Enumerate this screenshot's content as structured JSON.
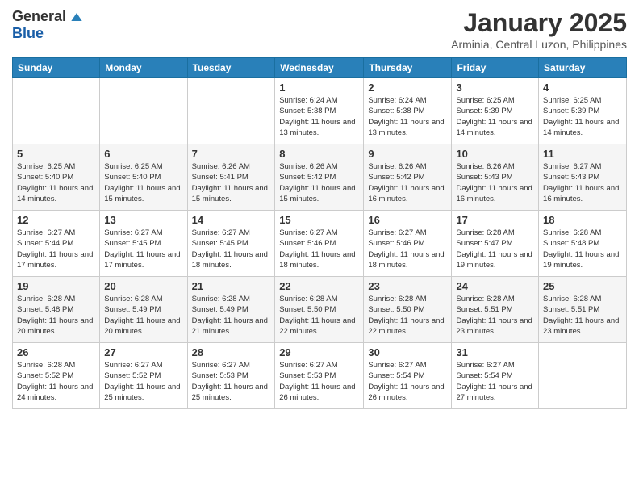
{
  "logo": {
    "general": "General",
    "blue": "Blue"
  },
  "title": "January 2025",
  "location": "Arminia, Central Luzon, Philippines",
  "days_of_week": [
    "Sunday",
    "Monday",
    "Tuesday",
    "Wednesday",
    "Thursday",
    "Friday",
    "Saturday"
  ],
  "weeks": [
    [
      {
        "day": "",
        "sunrise": "",
        "sunset": "",
        "daylight": ""
      },
      {
        "day": "",
        "sunrise": "",
        "sunset": "",
        "daylight": ""
      },
      {
        "day": "",
        "sunrise": "",
        "sunset": "",
        "daylight": ""
      },
      {
        "day": "1",
        "sunrise": "6:24 AM",
        "sunset": "5:38 PM",
        "daylight": "11 hours and 13 minutes."
      },
      {
        "day": "2",
        "sunrise": "6:24 AM",
        "sunset": "5:38 PM",
        "daylight": "11 hours and 13 minutes."
      },
      {
        "day": "3",
        "sunrise": "6:25 AM",
        "sunset": "5:39 PM",
        "daylight": "11 hours and 14 minutes."
      },
      {
        "day": "4",
        "sunrise": "6:25 AM",
        "sunset": "5:39 PM",
        "daylight": "11 hours and 14 minutes."
      }
    ],
    [
      {
        "day": "5",
        "sunrise": "6:25 AM",
        "sunset": "5:40 PM",
        "daylight": "11 hours and 14 minutes."
      },
      {
        "day": "6",
        "sunrise": "6:25 AM",
        "sunset": "5:40 PM",
        "daylight": "11 hours and 15 minutes."
      },
      {
        "day": "7",
        "sunrise": "6:26 AM",
        "sunset": "5:41 PM",
        "daylight": "11 hours and 15 minutes."
      },
      {
        "day": "8",
        "sunrise": "6:26 AM",
        "sunset": "5:42 PM",
        "daylight": "11 hours and 15 minutes."
      },
      {
        "day": "9",
        "sunrise": "6:26 AM",
        "sunset": "5:42 PM",
        "daylight": "11 hours and 16 minutes."
      },
      {
        "day": "10",
        "sunrise": "6:26 AM",
        "sunset": "5:43 PM",
        "daylight": "11 hours and 16 minutes."
      },
      {
        "day": "11",
        "sunrise": "6:27 AM",
        "sunset": "5:43 PM",
        "daylight": "11 hours and 16 minutes."
      }
    ],
    [
      {
        "day": "12",
        "sunrise": "6:27 AM",
        "sunset": "5:44 PM",
        "daylight": "11 hours and 17 minutes."
      },
      {
        "day": "13",
        "sunrise": "6:27 AM",
        "sunset": "5:45 PM",
        "daylight": "11 hours and 17 minutes."
      },
      {
        "day": "14",
        "sunrise": "6:27 AM",
        "sunset": "5:45 PM",
        "daylight": "11 hours and 18 minutes."
      },
      {
        "day": "15",
        "sunrise": "6:27 AM",
        "sunset": "5:46 PM",
        "daylight": "11 hours and 18 minutes."
      },
      {
        "day": "16",
        "sunrise": "6:27 AM",
        "sunset": "5:46 PM",
        "daylight": "11 hours and 18 minutes."
      },
      {
        "day": "17",
        "sunrise": "6:28 AM",
        "sunset": "5:47 PM",
        "daylight": "11 hours and 19 minutes."
      },
      {
        "day": "18",
        "sunrise": "6:28 AM",
        "sunset": "5:48 PM",
        "daylight": "11 hours and 19 minutes."
      }
    ],
    [
      {
        "day": "19",
        "sunrise": "6:28 AM",
        "sunset": "5:48 PM",
        "daylight": "11 hours and 20 minutes."
      },
      {
        "day": "20",
        "sunrise": "6:28 AM",
        "sunset": "5:49 PM",
        "daylight": "11 hours and 20 minutes."
      },
      {
        "day": "21",
        "sunrise": "6:28 AM",
        "sunset": "5:49 PM",
        "daylight": "11 hours and 21 minutes."
      },
      {
        "day": "22",
        "sunrise": "6:28 AM",
        "sunset": "5:50 PM",
        "daylight": "11 hours and 22 minutes."
      },
      {
        "day": "23",
        "sunrise": "6:28 AM",
        "sunset": "5:50 PM",
        "daylight": "11 hours and 22 minutes."
      },
      {
        "day": "24",
        "sunrise": "6:28 AM",
        "sunset": "5:51 PM",
        "daylight": "11 hours and 23 minutes."
      },
      {
        "day": "25",
        "sunrise": "6:28 AM",
        "sunset": "5:51 PM",
        "daylight": "11 hours and 23 minutes."
      }
    ],
    [
      {
        "day": "26",
        "sunrise": "6:28 AM",
        "sunset": "5:52 PM",
        "daylight": "11 hours and 24 minutes."
      },
      {
        "day": "27",
        "sunrise": "6:27 AM",
        "sunset": "5:52 PM",
        "daylight": "11 hours and 25 minutes."
      },
      {
        "day": "28",
        "sunrise": "6:27 AM",
        "sunset": "5:53 PM",
        "daylight": "11 hours and 25 minutes."
      },
      {
        "day": "29",
        "sunrise": "6:27 AM",
        "sunset": "5:53 PM",
        "daylight": "11 hours and 26 minutes."
      },
      {
        "day": "30",
        "sunrise": "6:27 AM",
        "sunset": "5:54 PM",
        "daylight": "11 hours and 26 minutes."
      },
      {
        "day": "31",
        "sunrise": "6:27 AM",
        "sunset": "5:54 PM",
        "daylight": "11 hours and 27 minutes."
      },
      {
        "day": "",
        "sunrise": "",
        "sunset": "",
        "daylight": ""
      }
    ]
  ]
}
